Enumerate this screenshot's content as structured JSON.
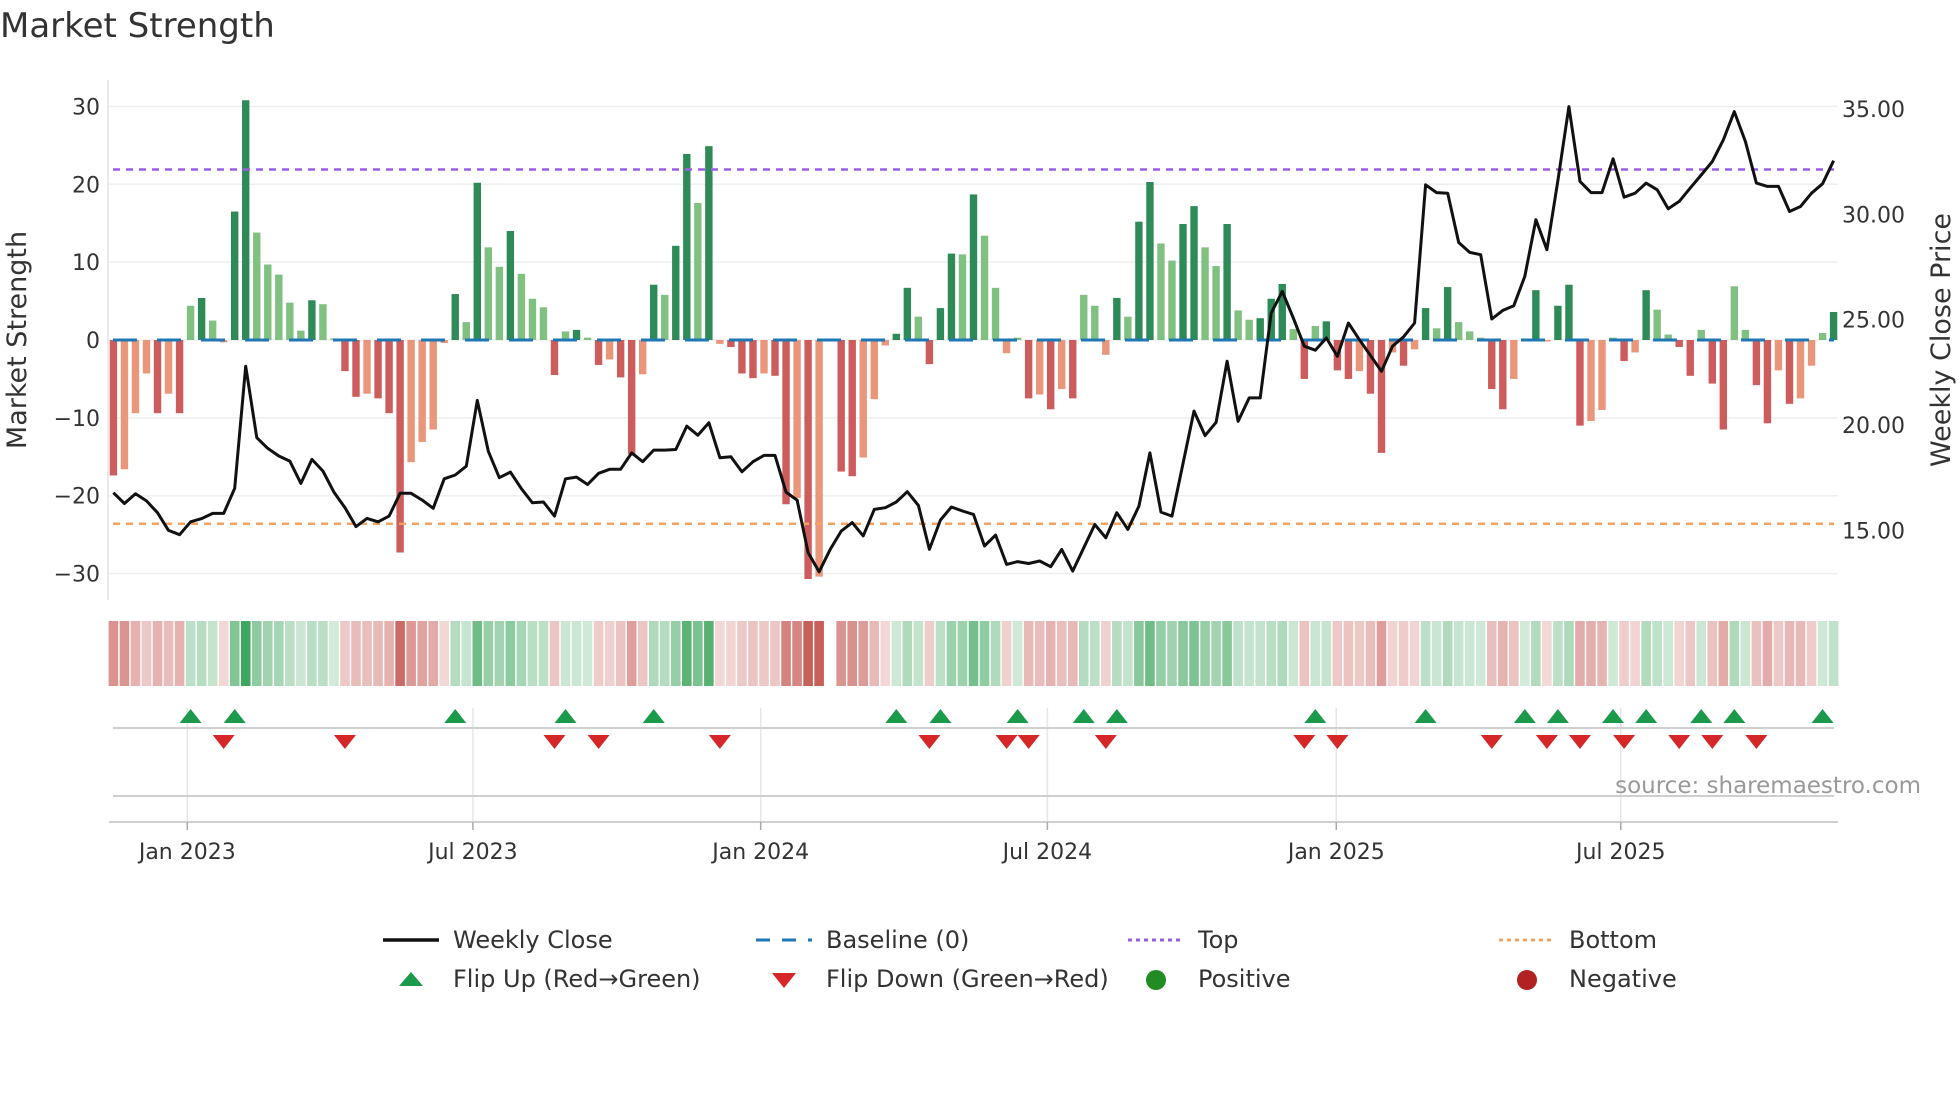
{
  "title": "Market Strength",
  "source": "source: sharemaestro.com",
  "colors": {
    "pos_dark": "#2e8b57",
    "pos_light": "#80c080",
    "neg_dark": "#cd5c5c",
    "neg_light": "#e9967a",
    "close": "#111111",
    "baseline": "#1f77b4",
    "top": "#9b5de5",
    "bottom": "#f4a261",
    "flip_up": "#1a9a4a",
    "flip_down": "#d62728",
    "positive": "#228b22",
    "negative": "#b22222"
  },
  "legend": [
    {
      "label": "Weekly Close",
      "kind": "line"
    },
    {
      "label": "Baseline (0)",
      "kind": "baseline"
    },
    {
      "label": "Top",
      "kind": "top"
    },
    {
      "label": "Bottom",
      "kind": "bottom"
    },
    {
      "label": "Flip Up (Red→Green)",
      "kind": "up"
    },
    {
      "label": "Flip Down (Green→Red)",
      "kind": "down"
    },
    {
      "label": "Positive",
      "kind": "positive"
    },
    {
      "label": "Negative",
      "kind": "negative"
    }
  ],
  "chart_data": {
    "type": "bar",
    "title": "Market Strength",
    "ylabel": "Market Strength",
    "y2label": "Weekly Close Price",
    "ylim": [
      -33.4,
      33.4
    ],
    "y2lim": [
      11.7,
      36.37
    ],
    "xlim": [
      -0.4,
      156.4
    ],
    "left_ticks": [
      {
        "v": 30,
        "label": "30"
      },
      {
        "v": 20,
        "label": "20"
      },
      {
        "v": 10,
        "label": "10"
      },
      {
        "v": 0,
        "label": "0"
      },
      {
        "v": -10,
        "label": "−10"
      },
      {
        "v": -20,
        "label": "−20"
      },
      {
        "v": -30,
        "label": "−30"
      }
    ],
    "right_ticks": [
      {
        "v": 35,
        "label": "35.00"
      },
      {
        "v": 30,
        "label": "30.00"
      },
      {
        "v": 25,
        "label": "25.00"
      },
      {
        "v": 20,
        "label": "20.00"
      },
      {
        "v": 15,
        "label": "15.00"
      }
    ],
    "x_ticks": [
      {
        "week": 6.7,
        "label": "Jan 2023"
      },
      {
        "week": 32.6,
        "label": "Jul 2023"
      },
      {
        "week": 58.7,
        "label": "Jan 2024"
      },
      {
        "week": 84.7,
        "label": "Jul 2024"
      },
      {
        "week": 110.9,
        "label": "Jan 2025"
      },
      {
        "week": 136.7,
        "label": "Jul 2025"
      }
    ],
    "top_level": 21.9,
    "bottom_level": -23.6,
    "baseline": 0,
    "strength": [
      -17.4,
      -16.6,
      -9.4,
      -4.3,
      -9.4,
      -6.9,
      -9.4,
      4.4,
      5.4,
      2.5,
      -0.3,
      16.5,
      30.8,
      13.8,
      9.7,
      8.4,
      4.8,
      1.2,
      5.1,
      4.6,
      0.2,
      -4,
      -7.3,
      -6.9,
      -7.5,
      -9.4,
      -27.3,
      -15.7,
      -13.1,
      -11.5,
      -0.4,
      5.9,
      2.3,
      20.2,
      11.9,
      9.4,
      14,
      8.5,
      5.3,
      4.2,
      -4.5,
      1.1,
      1.3,
      0.3,
      -3.2,
      -2.5,
      -4.8,
      -14.7,
      -4.4,
      7.1,
      5.8,
      12.1,
      23.9,
      17.6,
      24.9,
      -0.5,
      -0.9,
      -4.3,
      -4.9,
      -4.3,
      -4.6,
      -21.1,
      -20.3,
      -30.7,
      -30.4,
      0,
      -16.9,
      -17.5,
      -15.1,
      -7.6,
      -0.7,
      0.8,
      6.7,
      3.0,
      -3.1,
      4.1,
      11.1,
      11.0,
      18.7,
      13.4,
      6.7,
      -1.7,
      0.3,
      -7.5,
      -7,
      -8.9,
      -6.3,
      -7.5,
      5.8,
      4.4,
      -1.9,
      5.4,
      3.0,
      15.2,
      20.3,
      12.4,
      10.2,
      14.9,
      17.2,
      11.9,
      9.5,
      14.9,
      3.8,
      2.6,
      2.8,
      5.3,
      7.2,
      1.4,
      -5,
      1.8,
      2.4,
      -3.9,
      -5,
      -4,
      -6.9,
      -14.5,
      -1.6,
      -3.3,
      -1.2,
      4.1,
      1.5,
      6.8,
      2.3,
      1.1,
      0.3,
      -6.3,
      -8.9,
      -5,
      0.2,
      6.4,
      -0.2,
      4.4,
      7.1,
      -11,
      -10.4,
      -9,
      0.3,
      -2.7,
      -1.6,
      6.4,
      3.9,
      0.7,
      -0.9,
      -4.6,
      1.3,
      -5.6,
      -11.5,
      6.9,
      1.3,
      -5.8,
      -10.7,
      -3.9,
      -8.2,
      -7.5,
      -3.3,
      0.9,
      3.6
    ],
    "close": [
      16.79,
      16.28,
      16.74,
      16.4,
      15.84,
      15.0,
      14.8,
      15.41,
      15.56,
      15.81,
      15.81,
      17.0,
      22.79,
      19.4,
      18.89,
      18.53,
      18.29,
      17.23,
      18.37,
      17.82,
      16.82,
      16.08,
      15.18,
      15.57,
      15.41,
      15.68,
      16.76,
      16.76,
      16.44,
      16.05,
      17.45,
      17.63,
      18.05,
      21.17,
      18.76,
      17.5,
      17.77,
      16.98,
      16.31,
      16.35,
      15.68,
      17.45,
      17.53,
      17.18,
      17.71,
      17.9,
      17.9,
      18.68,
      18.26,
      18.81,
      18.81,
      18.84,
      19.95,
      19.52,
      20.11,
      18.45,
      18.5,
      17.78,
      18.26,
      18.56,
      18.56,
      16.82,
      16.44,
      13.95,
      13.04,
      14.1,
      14.97,
      15.37,
      14.74,
      16.0,
      16.08,
      16.35,
      16.84,
      16.19,
      14.1,
      15.49,
      16.11,
      15.92,
      15.76,
      14.26,
      14.78,
      13.39,
      13.52,
      13.43,
      13.55,
      13.28,
      14.1,
      13.07,
      14.18,
      15.28,
      14.65,
      15.84,
      15.05,
      16.15,
      18.68,
      15.87,
      15.68,
      18.17,
      20.66,
      19.5,
      20.13,
      23.03,
      20.18,
      21.29,
      21.29,
      25.32,
      26.34,
      25.08,
      23.74,
      23.55,
      24.13,
      23.26,
      24.84,
      24.05,
      23.3,
      22.55,
      23.74,
      24.18,
      24.84,
      31.4,
      31.03,
      31.0,
      28.66,
      28.19,
      28.08,
      25.03,
      25.44,
      25.66,
      27.05,
      29.74,
      28.32,
      31.6,
      35.11,
      31.56,
      31.03,
      31.03,
      32.63,
      30.81,
      31.0,
      31.48,
      31.16,
      30.26,
      30.61,
      31.24,
      31.87,
      32.5,
      33.53,
      34.87,
      33.45,
      31.48,
      31.32,
      31.32,
      30.13,
      30.37,
      31.0,
      31.45,
      32.54
    ]
  }
}
